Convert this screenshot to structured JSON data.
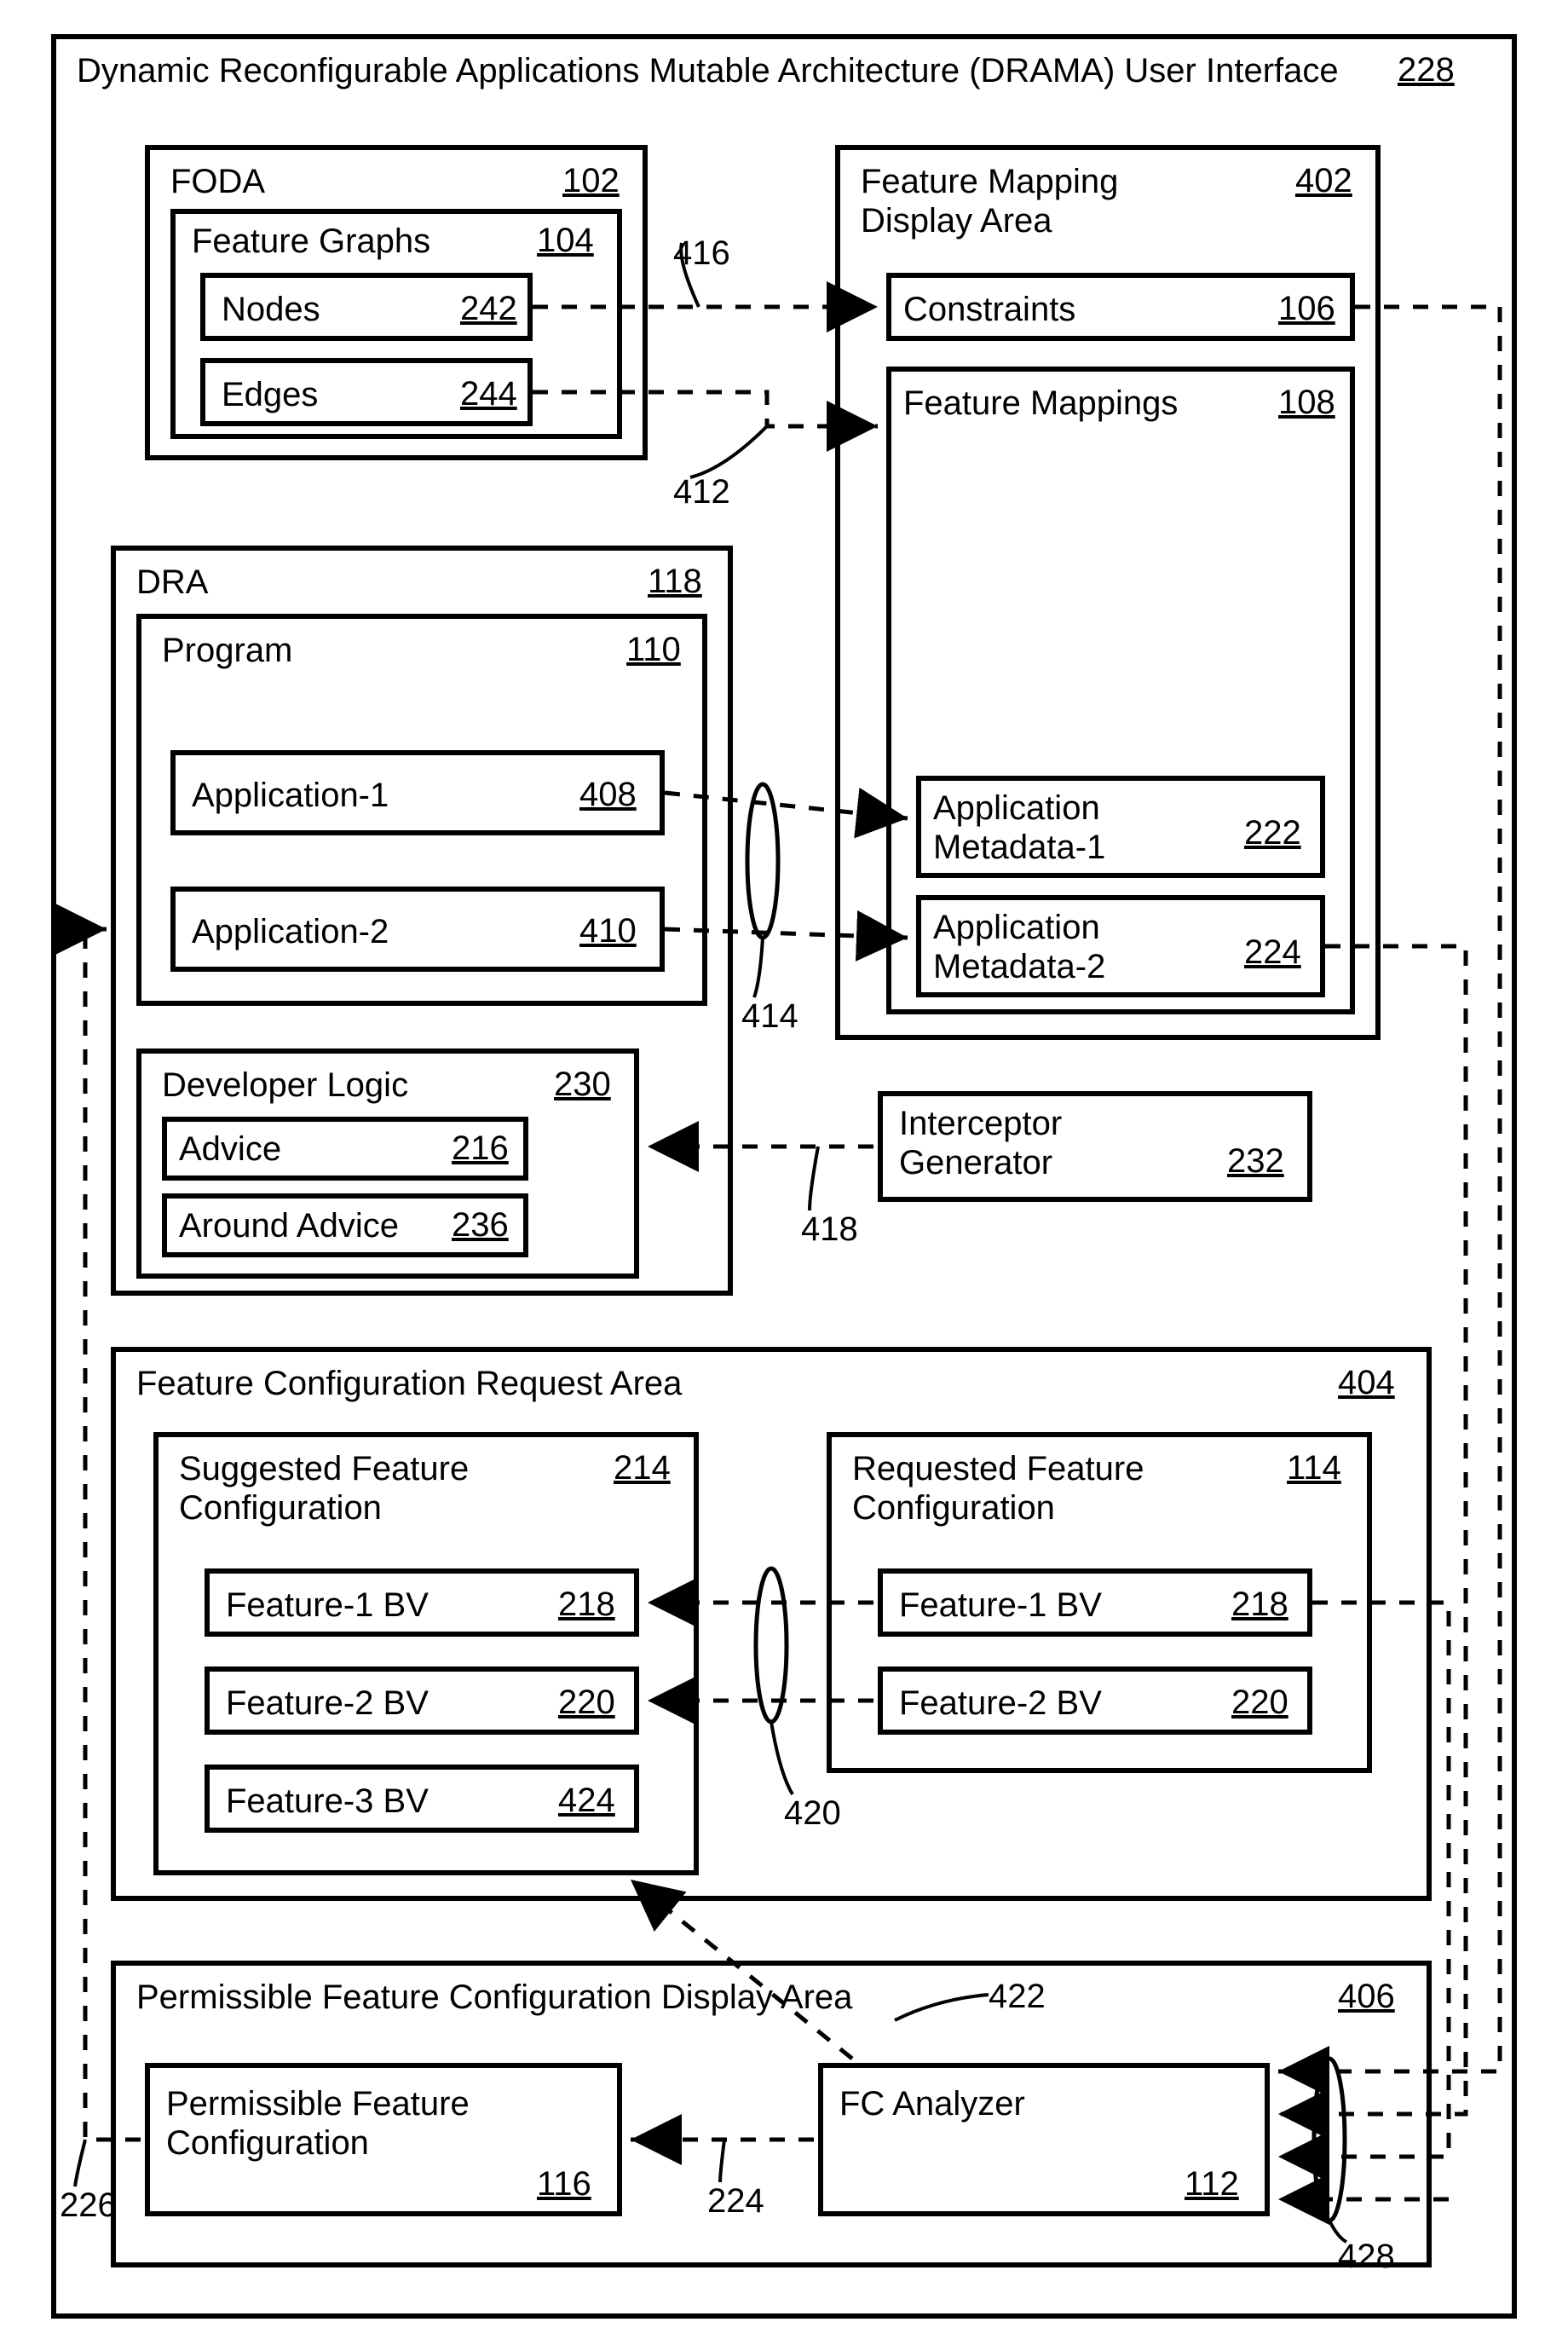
{
  "outer": {
    "title": "Dynamic Reconfigurable Applications Mutable Architecture (DRAMA) User Interface",
    "ref": "228"
  },
  "foda": {
    "title": "FODA",
    "ref": "102",
    "feature_graphs": {
      "title": "Feature Graphs",
      "ref": "104"
    },
    "nodes": {
      "title": "Nodes",
      "ref": "242"
    },
    "edges": {
      "title": "Edges",
      "ref": "244"
    }
  },
  "fmda": {
    "title": "Feature Mapping\nDisplay Area",
    "ref": "402",
    "constraints": {
      "title": "Constraints",
      "ref": "106"
    },
    "feature_mappings": {
      "title": "Feature Mappings",
      "ref": "108"
    },
    "meta1": {
      "title": "Application\nMetadata-1",
      "ref": "222"
    },
    "meta2": {
      "title": "Application\nMetadata-2",
      "ref": "224"
    }
  },
  "dra": {
    "title": "DRA",
    "ref": "118",
    "program": {
      "title": "Program",
      "ref": "110"
    },
    "app1": {
      "title": "Application-1",
      "ref": "408"
    },
    "app2": {
      "title": "Application-2",
      "ref": "410"
    },
    "devlogic": {
      "title": "Developer Logic",
      "ref": "230"
    },
    "advice": {
      "title": "Advice",
      "ref": "216"
    },
    "around": {
      "title": "Around Advice",
      "ref": "236"
    }
  },
  "interceptor": {
    "title": "Interceptor\nGenerator",
    "ref": "232"
  },
  "fcra": {
    "title": "Feature Configuration Request Area",
    "ref": "404",
    "suggested": {
      "title": "Suggested Feature\nConfiguration",
      "ref": "214"
    },
    "requested": {
      "title": "Requested Feature\nConfiguration",
      "ref": "114"
    },
    "f1": {
      "title": "Feature-1 BV",
      "ref": "218"
    },
    "f2": {
      "title": "Feature-2 BV",
      "ref": "220"
    },
    "f3": {
      "title": "Feature-3 BV",
      "ref": "424"
    },
    "rf1": {
      "title": "Feature-1 BV",
      "ref": "218"
    },
    "rf2": {
      "title": "Feature-2 BV",
      "ref": "220"
    }
  },
  "pfcda": {
    "title": "Permissible Feature Configuration Display Area",
    "ref": "406",
    "pfc": {
      "title": "Permissible Feature\nConfiguration",
      "ref": "116"
    },
    "analyzer": {
      "title": "FC Analyzer",
      "ref": "112"
    }
  },
  "arrows": {
    "a412": "412",
    "a414": "414",
    "a416": "416",
    "a418": "418",
    "a420": "420",
    "a422": "422",
    "a224": "224",
    "a226": "226",
    "a428": "428"
  }
}
